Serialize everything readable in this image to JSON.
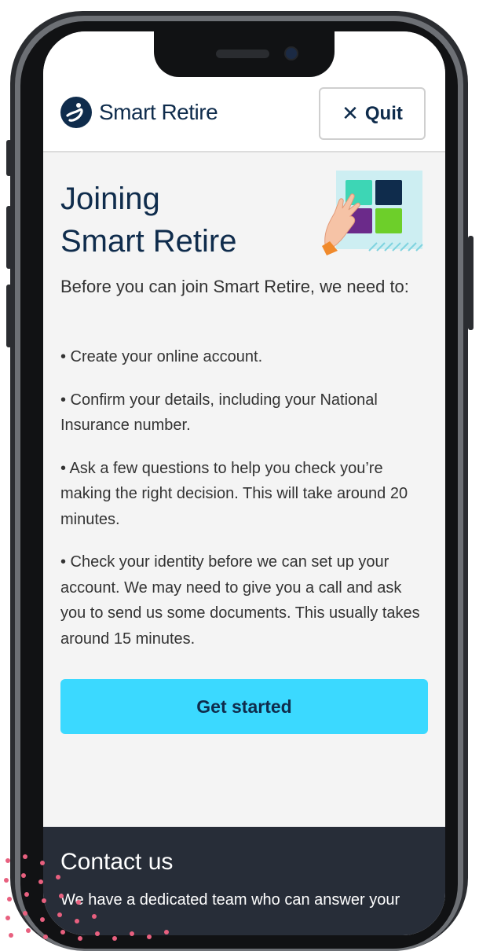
{
  "brand": {
    "name": "Smart Retire",
    "primary_color": "#0f2c4c",
    "accent_color": "#3bd9ff"
  },
  "header": {
    "quit_label": "Quit",
    "quit_icon": "close-icon"
  },
  "page": {
    "title_line1": "Joining",
    "title_line2": "Smart Retire",
    "intro": "Before you can join Smart Retire, we need to:",
    "steps": [
      "• Create your online account.",
      "• Confirm your details, including your National Insurance number.",
      "• Ask a few questions to help you check you’re making the right decision. This will take around 20 minutes.",
      "• Check your identity before we can set up your account. We may need to give you a call and ask you to send us some documents. This usually takes around 15 minutes."
    ],
    "cta_label": "Get started"
  },
  "footer": {
    "title": "Contact us",
    "text": "We have a dedicated team who can answer your"
  }
}
